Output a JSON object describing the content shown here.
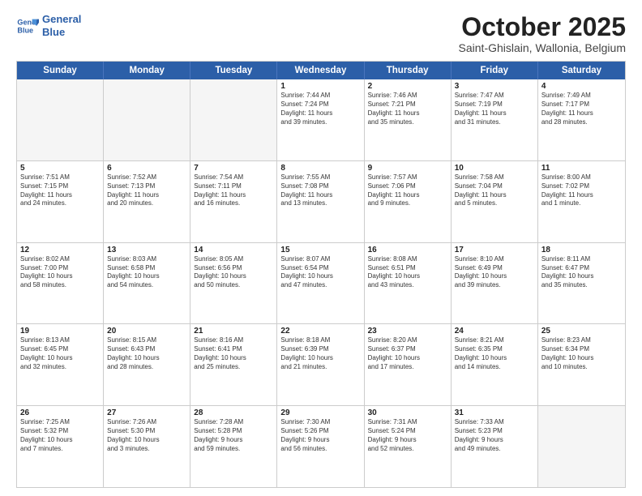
{
  "logo": {
    "line1": "General",
    "line2": "Blue"
  },
  "title": "October 2025",
  "subtitle": "Saint-Ghislain, Wallonia, Belgium",
  "header_days": [
    "Sunday",
    "Monday",
    "Tuesday",
    "Wednesday",
    "Thursday",
    "Friday",
    "Saturday"
  ],
  "rows": [
    [
      {
        "day": "",
        "text": ""
      },
      {
        "day": "",
        "text": ""
      },
      {
        "day": "",
        "text": ""
      },
      {
        "day": "1",
        "text": "Sunrise: 7:44 AM\nSunset: 7:24 PM\nDaylight: 11 hours\nand 39 minutes."
      },
      {
        "day": "2",
        "text": "Sunrise: 7:46 AM\nSunset: 7:21 PM\nDaylight: 11 hours\nand 35 minutes."
      },
      {
        "day": "3",
        "text": "Sunrise: 7:47 AM\nSunset: 7:19 PM\nDaylight: 11 hours\nand 31 minutes."
      },
      {
        "day": "4",
        "text": "Sunrise: 7:49 AM\nSunset: 7:17 PM\nDaylight: 11 hours\nand 28 minutes."
      }
    ],
    [
      {
        "day": "5",
        "text": "Sunrise: 7:51 AM\nSunset: 7:15 PM\nDaylight: 11 hours\nand 24 minutes."
      },
      {
        "day": "6",
        "text": "Sunrise: 7:52 AM\nSunset: 7:13 PM\nDaylight: 11 hours\nand 20 minutes."
      },
      {
        "day": "7",
        "text": "Sunrise: 7:54 AM\nSunset: 7:11 PM\nDaylight: 11 hours\nand 16 minutes."
      },
      {
        "day": "8",
        "text": "Sunrise: 7:55 AM\nSunset: 7:08 PM\nDaylight: 11 hours\nand 13 minutes."
      },
      {
        "day": "9",
        "text": "Sunrise: 7:57 AM\nSunset: 7:06 PM\nDaylight: 11 hours\nand 9 minutes."
      },
      {
        "day": "10",
        "text": "Sunrise: 7:58 AM\nSunset: 7:04 PM\nDaylight: 11 hours\nand 5 minutes."
      },
      {
        "day": "11",
        "text": "Sunrise: 8:00 AM\nSunset: 7:02 PM\nDaylight: 11 hours\nand 1 minute."
      }
    ],
    [
      {
        "day": "12",
        "text": "Sunrise: 8:02 AM\nSunset: 7:00 PM\nDaylight: 10 hours\nand 58 minutes."
      },
      {
        "day": "13",
        "text": "Sunrise: 8:03 AM\nSunset: 6:58 PM\nDaylight: 10 hours\nand 54 minutes."
      },
      {
        "day": "14",
        "text": "Sunrise: 8:05 AM\nSunset: 6:56 PM\nDaylight: 10 hours\nand 50 minutes."
      },
      {
        "day": "15",
        "text": "Sunrise: 8:07 AM\nSunset: 6:54 PM\nDaylight: 10 hours\nand 47 minutes."
      },
      {
        "day": "16",
        "text": "Sunrise: 8:08 AM\nSunset: 6:51 PM\nDaylight: 10 hours\nand 43 minutes."
      },
      {
        "day": "17",
        "text": "Sunrise: 8:10 AM\nSunset: 6:49 PM\nDaylight: 10 hours\nand 39 minutes."
      },
      {
        "day": "18",
        "text": "Sunrise: 8:11 AM\nSunset: 6:47 PM\nDaylight: 10 hours\nand 35 minutes."
      }
    ],
    [
      {
        "day": "19",
        "text": "Sunrise: 8:13 AM\nSunset: 6:45 PM\nDaylight: 10 hours\nand 32 minutes."
      },
      {
        "day": "20",
        "text": "Sunrise: 8:15 AM\nSunset: 6:43 PM\nDaylight: 10 hours\nand 28 minutes."
      },
      {
        "day": "21",
        "text": "Sunrise: 8:16 AM\nSunset: 6:41 PM\nDaylight: 10 hours\nand 25 minutes."
      },
      {
        "day": "22",
        "text": "Sunrise: 8:18 AM\nSunset: 6:39 PM\nDaylight: 10 hours\nand 21 minutes."
      },
      {
        "day": "23",
        "text": "Sunrise: 8:20 AM\nSunset: 6:37 PM\nDaylight: 10 hours\nand 17 minutes."
      },
      {
        "day": "24",
        "text": "Sunrise: 8:21 AM\nSunset: 6:35 PM\nDaylight: 10 hours\nand 14 minutes."
      },
      {
        "day": "25",
        "text": "Sunrise: 8:23 AM\nSunset: 6:34 PM\nDaylight: 10 hours\nand 10 minutes."
      }
    ],
    [
      {
        "day": "26",
        "text": "Sunrise: 7:25 AM\nSunset: 5:32 PM\nDaylight: 10 hours\nand 7 minutes."
      },
      {
        "day": "27",
        "text": "Sunrise: 7:26 AM\nSunset: 5:30 PM\nDaylight: 10 hours\nand 3 minutes."
      },
      {
        "day": "28",
        "text": "Sunrise: 7:28 AM\nSunset: 5:28 PM\nDaylight: 9 hours\nand 59 minutes."
      },
      {
        "day": "29",
        "text": "Sunrise: 7:30 AM\nSunset: 5:26 PM\nDaylight: 9 hours\nand 56 minutes."
      },
      {
        "day": "30",
        "text": "Sunrise: 7:31 AM\nSunset: 5:24 PM\nDaylight: 9 hours\nand 52 minutes."
      },
      {
        "day": "31",
        "text": "Sunrise: 7:33 AM\nSunset: 5:23 PM\nDaylight: 9 hours\nand 49 minutes."
      },
      {
        "day": "",
        "text": ""
      }
    ]
  ]
}
